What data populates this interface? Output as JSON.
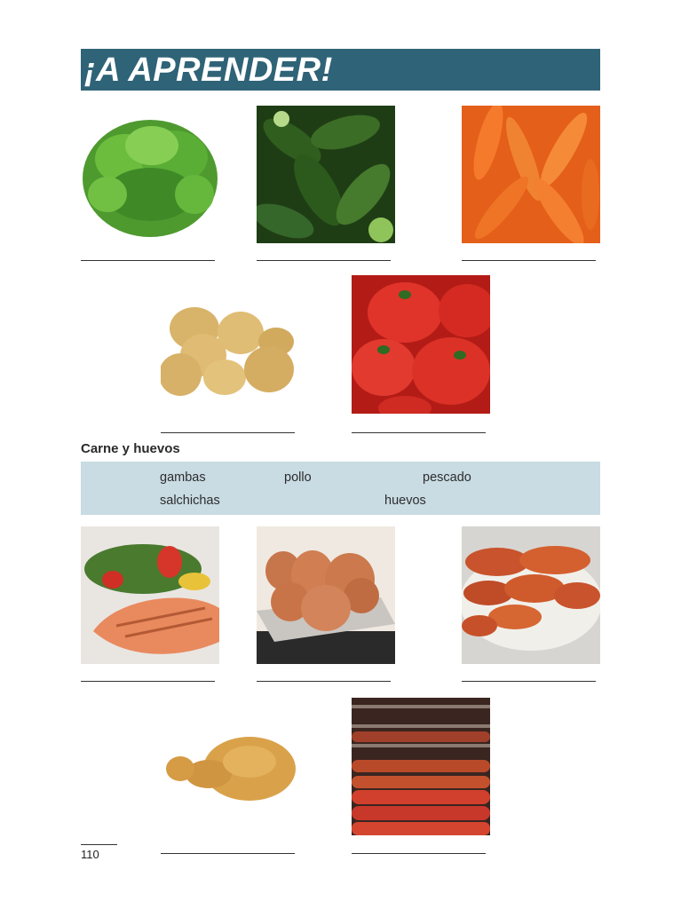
{
  "banner": {
    "title": "¡A APRENDER!"
  },
  "section": {
    "title": "Carne y huevos"
  },
  "word_bank": {
    "words": [
      "gambas",
      "pollo",
      "pescado",
      "salchichas",
      "huevos"
    ]
  },
  "images": {
    "vegetables": [
      "lettuce-photo",
      "cucumbers-photo",
      "carrots-photo",
      "potatoes-photo",
      "tomatoes-photo"
    ],
    "proteins": [
      "salmon-photo",
      "eggs-photo",
      "shrimp-photo",
      "fried-chicken-photo",
      "sausages-photo"
    ]
  },
  "colors": {
    "banner": "#2f6377",
    "word_bank": "#c9dbe3"
  },
  "footer": {
    "page_number": "110"
  }
}
